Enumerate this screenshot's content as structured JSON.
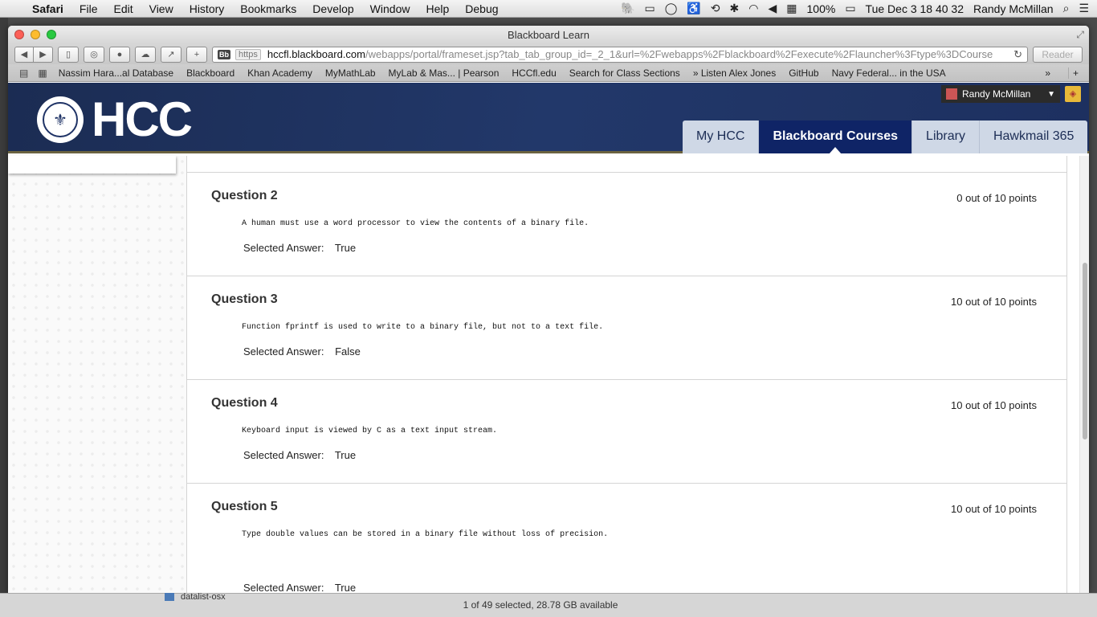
{
  "menubar": {
    "app": "Safari",
    "items": [
      "File",
      "Edit",
      "View",
      "History",
      "Bookmarks",
      "Develop",
      "Window",
      "Help",
      "Debug"
    ],
    "battery": "100%",
    "clock": "Tue Dec 3  18 40 32",
    "user": "Randy McMillan"
  },
  "window": {
    "title": "Blackboard Learn"
  },
  "address": {
    "scheme": "https",
    "host": "hccfl.blackboard.com",
    "path": "/webapps/portal/frameset.jsp?tab_tab_group_id=_2_1&url=%2Fwebapps%2Fblackboard%2Fexecute%2Flauncher%3Ftype%3DCourse",
    "reader": "Reader"
  },
  "bookmarks": [
    "Nassim Hara...al Database",
    "Blackboard",
    "Khan Academy",
    "MyMathLab",
    "MyLab & Mas... | Pearson",
    "HCCfl.edu",
    "Search for Class Sections",
    "» Listen Alex Jones",
    "GitHub",
    "Navy Federal... in the USA"
  ],
  "header": {
    "logo_text": "HCC",
    "user_name": "Randy McMillan",
    "tabs": [
      {
        "label": "My HCC",
        "active": false
      },
      {
        "label": "Blackboard Courses",
        "active": true
      },
      {
        "label": "Library",
        "active": false
      },
      {
        "label": "Hawkmail 365",
        "active": false
      }
    ]
  },
  "questions": [
    {
      "title": "Question 2",
      "points": "0 out of 10 points",
      "text": "A human must use a word processor to view the contents of a binary file.",
      "answer_label": "Selected Answer:",
      "answer": "True"
    },
    {
      "title": "Question 3",
      "points": "10 out of 10 points",
      "text": "Function fprintf is used to write to a binary file, but not to a text file.",
      "answer_label": "Selected Answer:",
      "answer": "False"
    },
    {
      "title": "Question 4",
      "points": "10 out of 10 points",
      "text": "Keyboard input is viewed by C as a text input stream.",
      "answer_label": "Selected Answer:",
      "answer": "True"
    },
    {
      "title": "Question 5",
      "points": "10 out of 10 points",
      "text": "Type double values can be stored in a binary file without loss of precision.",
      "answer_label": "Selected Answer:",
      "answer": "True"
    }
  ],
  "finder": {
    "row_label": "datalist-osx",
    "status": "1 of 49 selected, 28.78 GB available"
  },
  "colors": {
    "header_bg": "#1d3060",
    "active_tab": "#0f2466",
    "inactive_tab": "#cfd8e6"
  }
}
